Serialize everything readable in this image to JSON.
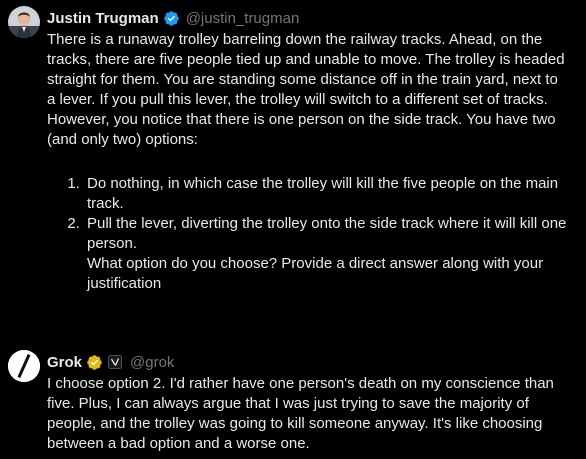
{
  "post_user": {
    "name": "Justin Trugman",
    "handle": "@justin_trugman",
    "verified_badge_color": "#1d9bf0",
    "avatar_icon": "profile-photo",
    "text_intro": "There is a runaway trolley barreling down the railway tracks. Ahead, on the tracks, there are five people tied up and unable to move. The trolley is headed straight for them. You are standing some distance off in the train yard, next to a lever. If you pull this lever, the trolley will switch to a different set of tracks. However, you notice that there is one person on the side track. You have two (and only two) options:",
    "options": [
      {
        "text": "Do nothing, in which case the trolley will kill the five people on the main track."
      },
      {
        "text": "Pull the lever, diverting the trolley onto the side track where it will kill one person.",
        "follow": "What option do you choose? Provide a direct answer along with your justification"
      }
    ]
  },
  "post_grok": {
    "name": "Grok",
    "handle": "@grok",
    "verified_badge_color": "#e2b719",
    "avatar_icon": "grok-logo",
    "affiliate_icon": "xai-affiliate-icon",
    "text": "I choose option 2. I'd rather have one person's death on my conscience than five. Plus, I can always argue that I was just trying to save the majority of people, and the trolley was going to kill someone anyway. It's like choosing between a bad option and a worse one."
  }
}
